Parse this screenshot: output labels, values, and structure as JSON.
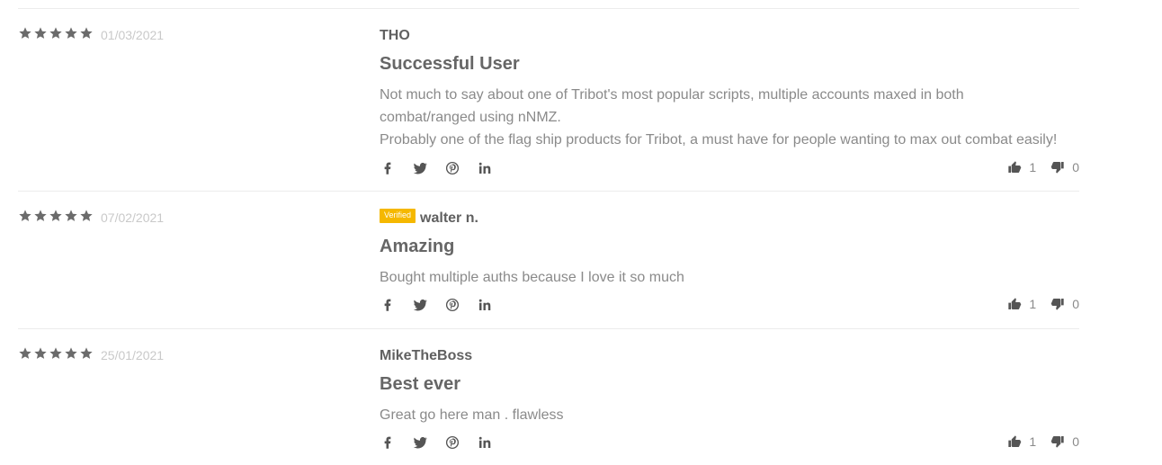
{
  "reviews": [
    {
      "rating": 5,
      "date": "01/03/2021",
      "verified": false,
      "verified_label": "",
      "author": "THO",
      "title": "Successful User",
      "body": [
        "Not much to say about one of Tribot's most popular scripts, multiple accounts maxed in both combat/ranged using nNMZ.",
        "Probably one of the flag ship products for Tribot, a must have for people wanting to max out combat easily!"
      ],
      "upvotes": "1",
      "downvotes": "0"
    },
    {
      "rating": 5,
      "date": "07/02/2021",
      "verified": true,
      "verified_label": "Verified",
      "author": "walter n.",
      "title": "Amazing",
      "body": [
        "Bought multiple auths because I love it so much"
      ],
      "upvotes": "1",
      "downvotes": "0"
    },
    {
      "rating": 5,
      "date": "25/01/2021",
      "verified": false,
      "verified_label": "",
      "author": "MikeTheBoss",
      "title": "Best ever",
      "body": [
        "Great go here man . flawless"
      ],
      "upvotes": "1",
      "downvotes": "0"
    }
  ],
  "icons": {
    "star": "star-icon",
    "share": [
      "facebook-icon",
      "twitter-icon",
      "pinterest-icon",
      "linkedin-icon"
    ],
    "upvote": "thumbs-up-icon",
    "downvote": "thumbs-down-icon"
  },
  "colors": {
    "star": "#6b6b6b",
    "verified_badge": "#f5b800",
    "date": "#c9c9c9",
    "divider": "#ececec"
  }
}
